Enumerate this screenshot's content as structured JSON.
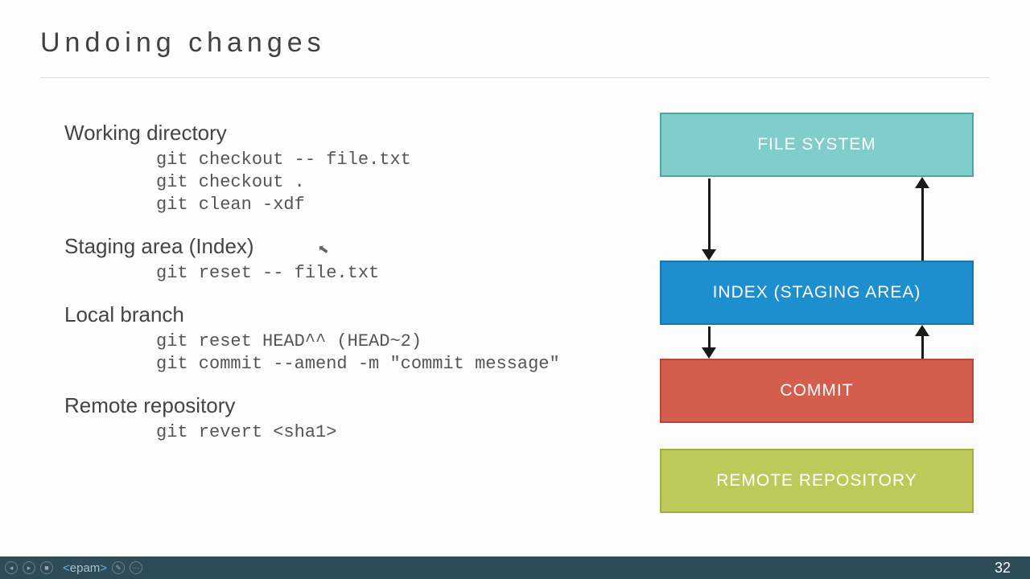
{
  "title": "Undoing changes",
  "sections": [
    {
      "heading": "Working directory",
      "code": "git checkout -- file.txt\ngit checkout .\ngit clean -xdf"
    },
    {
      "heading": "Staging area (Index)",
      "code": "git reset -- file.txt"
    },
    {
      "heading": "Local branch",
      "code": "git reset HEAD^^ (HEAD~2)\ngit commit --amend -m \"commit message\""
    },
    {
      "heading": "Remote repository",
      "code": "git revert <sha1>"
    }
  ],
  "diagram": {
    "boxes": [
      {
        "label": "FILE SYSTEM"
      },
      {
        "label": "INDEX (STAGING AREA)"
      },
      {
        "label": "COMMIT"
      },
      {
        "label": "REMOTE REPOSITORY"
      }
    ]
  },
  "footer": {
    "logo": "epam",
    "page": "32"
  }
}
